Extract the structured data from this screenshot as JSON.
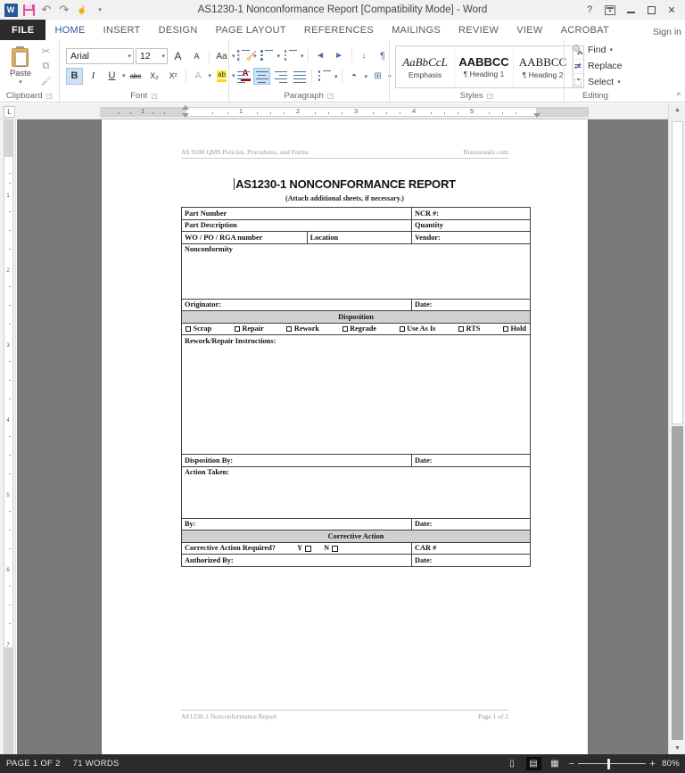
{
  "window": {
    "title": "AS1230-1 Nonconformance Report [Compatibility Mode] - Word",
    "quick_access": [
      {
        "name": "word-logo",
        "glyph": "W"
      },
      {
        "name": "save",
        "glyph": ""
      },
      {
        "name": "undo",
        "glyph": "↶"
      },
      {
        "name": "redo",
        "glyph": "↷"
      },
      {
        "name": "touch-mode",
        "glyph": "☝"
      }
    ],
    "controls": {
      "help": "?",
      "ribbon_options": "",
      "minimize": "",
      "restore": "",
      "close": "✕"
    },
    "sign_in": "Sign in"
  },
  "ribbon": {
    "tabs": [
      {
        "label": "FILE",
        "active": false,
        "file": true
      },
      {
        "label": "HOME",
        "active": true
      },
      {
        "label": "INSERT",
        "active": false
      },
      {
        "label": "DESIGN",
        "active": false
      },
      {
        "label": "PAGE LAYOUT",
        "active": false
      },
      {
        "label": "REFERENCES",
        "active": false
      },
      {
        "label": "MAILINGS",
        "active": false
      },
      {
        "label": "REVIEW",
        "active": false
      },
      {
        "label": "VIEW",
        "active": false
      },
      {
        "label": "ACROBAT",
        "active": false
      }
    ],
    "groups": {
      "clipboard": {
        "label": "Clipboard",
        "paste_label": "Paste",
        "cut": "✂",
        "copy": "⧉",
        "format_painter": "🖌"
      },
      "font": {
        "label": "Font",
        "font_name": "Arial",
        "font_size": "12",
        "grow_font": "A",
        "shrink_font": "A",
        "change_case": "Aa",
        "clear_formatting": "A",
        "bold": "B",
        "italic": "I",
        "underline": "U",
        "strikethrough": "abc",
        "subscript": "X₂",
        "superscript": "X²",
        "text_effects": "A",
        "highlight": "ab",
        "font_color": "A"
      },
      "paragraph": {
        "label": "Paragraph",
        "bullets": "bullets",
        "numbering": "numbering",
        "multilevel": "multilevel",
        "decrease_indent": "◄",
        "increase_indent": "►",
        "sort": "↓",
        "show_marks": "¶",
        "align_left": "align-left",
        "align_center": "align-center",
        "align_right": "align-right",
        "justify": "justify",
        "line_spacing": "line-spacing",
        "shading": "shading",
        "borders": "borders"
      },
      "styles": {
        "label": "Styles",
        "items": [
          {
            "preview": "AaBbCcL",
            "name": "Emphasis",
            "style": "emph"
          },
          {
            "preview": "AABBCC",
            "name": "¶ Heading 1",
            "style": "h1"
          },
          {
            "preview": "AABBCC",
            "name": "¶ Heading 2",
            "style": "h2"
          }
        ]
      },
      "editing": {
        "label": "Editing",
        "find": "Find",
        "replace": "Replace",
        "select": "Select"
      }
    },
    "collapse": "^"
  },
  "ruler": {
    "tab_selector": "L",
    "h_numbers": [
      "1",
      "1",
      "2",
      "3",
      "4",
      "5",
      ""
    ],
    "v_numbers": [
      "1",
      "2",
      "3",
      "4",
      "5",
      "6",
      "7"
    ]
  },
  "document": {
    "header": {
      "left": "AS 9100 QMS Policies, Procedures, and Forms",
      "right": "Bizmanualz.com"
    },
    "title": "AS1230-1 NONCONFORMANCE REPORT",
    "subtitle": "(Attach additional sheets, if necessary.)",
    "fields": {
      "part_number": "Part Number",
      "ncr_number": "NCR #:",
      "part_description": "Part Description",
      "quantity": "Quantity",
      "wo_po_rga": "WO / PO / RGA number",
      "location": "Location",
      "vendor": "Vendor:",
      "nonconformity": "Nonconformity",
      "originator": "Originator:",
      "date1": "Date:",
      "disposition_banner": "Disposition",
      "rework_instructions": "Rework/Repair Instructions:",
      "disposition_by": "Disposition By:",
      "date2": "Date:",
      "action_taken": "Action Taken:",
      "by": "By:",
      "date3": "Date:",
      "corrective_banner": "Corrective Action",
      "corrective_required": "Corrective Action Required?",
      "yes_label": "Y",
      "no_label": "N",
      "car_number": "CAR #",
      "authorized_by": "Authorized By:",
      "date4": "Date:"
    },
    "disposition_options": [
      "Scrap",
      "Repair",
      "Rework",
      "Regrade",
      "Use As Is",
      "RTS",
      "Hold"
    ],
    "footer": {
      "left": "AS1230-1 Nonconformance Report",
      "right": "Page 1 of 2"
    }
  },
  "status_bar": {
    "page": "PAGE 1 OF 2",
    "words": "71 WORDS",
    "views": [
      {
        "name": "read-mode",
        "glyph": "▯",
        "selected": false
      },
      {
        "name": "print-layout",
        "glyph": "▤",
        "selected": true
      },
      {
        "name": "web-layout",
        "glyph": "▦",
        "selected": false
      }
    ],
    "zoom_out": "−",
    "zoom_in": "+",
    "zoom_level": "80%"
  }
}
